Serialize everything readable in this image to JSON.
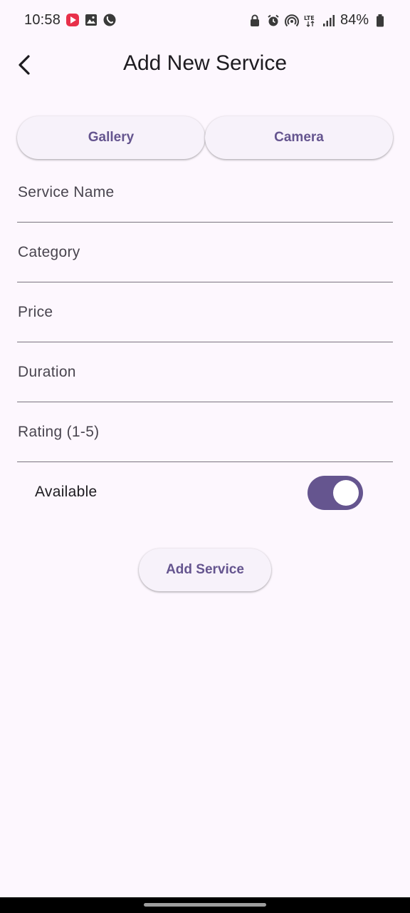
{
  "status_bar": {
    "time": "10:58",
    "battery": "84%",
    "left_icons": [
      "youtube-icon",
      "gallery-icon",
      "whatsapp-icon"
    ],
    "right_icons": [
      "lock-icon",
      "alarm-icon",
      "hotspot-icon",
      "lte-icon",
      "signal-icon",
      "battery-icon"
    ]
  },
  "app_bar": {
    "title": "Add New Service",
    "back_icon": "chevron-left-icon"
  },
  "image_source": {
    "gallery_label": "Gallery",
    "camera_label": "Camera"
  },
  "form": {
    "fields": [
      {
        "label": "Service Name",
        "value": ""
      },
      {
        "label": "Category",
        "value": ""
      },
      {
        "label": "Price",
        "value": ""
      },
      {
        "label": "Duration",
        "value": ""
      },
      {
        "label": "Rating (1-5)",
        "value": ""
      }
    ],
    "available": {
      "label": "Available",
      "checked": true
    },
    "submit_label": "Add Service"
  },
  "colors": {
    "background": "#fdf7fe",
    "accent": "#65558f",
    "button_surface": "#f7f2fa",
    "divider": "#7a757f"
  }
}
